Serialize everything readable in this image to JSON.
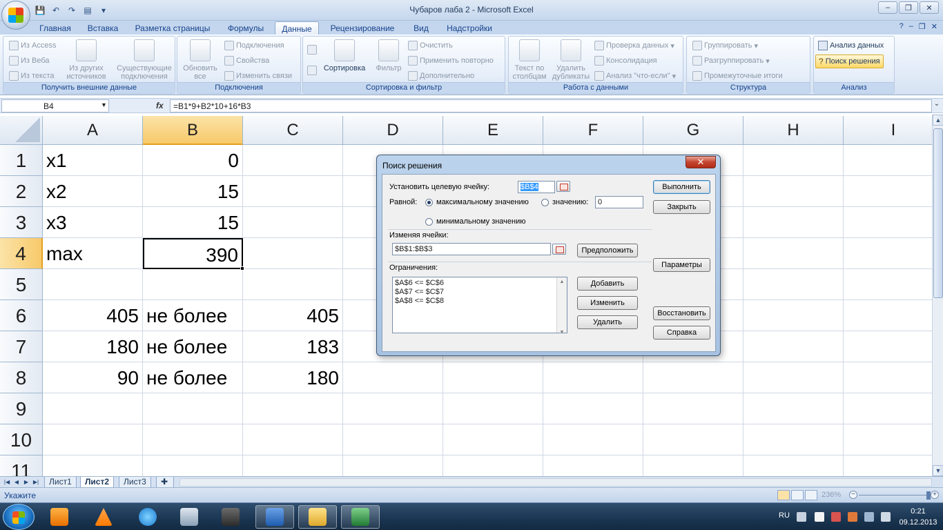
{
  "window": {
    "title": "Чубаров лаба 2 - Microsoft Excel",
    "controls": [
      "–",
      "❐",
      "✕"
    ]
  },
  "ribbon": {
    "tabs": [
      "Главная",
      "Вставка",
      "Разметка страницы",
      "Формулы",
      "Данные",
      "Рецензирование",
      "Вид",
      "Надстройки"
    ],
    "active_tab": "Данные",
    "groups": {
      "external": {
        "label": "Получить внешние данные",
        "from_access": "Из Access",
        "from_web": "Из Веба",
        "from_text": "Из текста",
        "other_sources_1": "Из других",
        "other_sources_2": "источников",
        "existing_1": "Существующие",
        "existing_2": "подключения"
      },
      "connections": {
        "label": "Подключения",
        "refresh_1": "Обновить",
        "refresh_2": "все",
        "connections": "Подключения",
        "properties": "Свойства",
        "edit_links": "Изменить связи"
      },
      "sort_filter": {
        "label": "Сортировка и фильтр",
        "sort": "Сортировка",
        "filter": "Фильтр",
        "clear": "Очистить",
        "reapply": "Применить повторно",
        "advanced": "Дополнительно"
      },
      "data_tools": {
        "label": "Работа с данными",
        "text_to_columns_1": "Текст по",
        "text_to_columns_2": "столбцам",
        "remove_dup_1": "Удалить",
        "remove_dup_2": "дубликаты",
        "validation": "Проверка данных",
        "consolidate": "Консолидация",
        "what_if": "Анализ \"что-если\""
      },
      "outline": {
        "label": "Структура",
        "group": "Группировать",
        "ungroup": "Разгруппировать",
        "subtotal": "Промежуточные итоги"
      },
      "analysis": {
        "label": "Анализ",
        "data_analysis": "Анализ данных",
        "solver": "Поиск решения"
      }
    }
  },
  "formula_bar": {
    "name_box": "B4",
    "fx": "fx",
    "formula": "=B1*9+B2*10+16*B3"
  },
  "grid": {
    "columns": [
      "A",
      "B",
      "C",
      "D",
      "E",
      "F",
      "G",
      "H",
      "I"
    ],
    "selected_column": "B",
    "rows": [
      "1",
      "2",
      "3",
      "4",
      "5",
      "6",
      "7",
      "8",
      "9",
      "10",
      "11"
    ],
    "selected_row": "4",
    "cells": {
      "A1": "x1",
      "B1": "0",
      "A2": "x2",
      "B2": "15",
      "A3": "x3",
      "B3": "15",
      "A4": "max",
      "B4": "390",
      "A6": "405",
      "B6": "не более",
      "C6": "405",
      "A7": "180",
      "B7": "не более",
      "C7": "183",
      "A8": "90",
      "B8": "не более",
      "C8": "180"
    }
  },
  "sheets": {
    "tabs": [
      "Лист1",
      "Лист2",
      "Лист3"
    ],
    "active": "Лист2"
  },
  "status": {
    "mode": "Укажите",
    "zoom": "236%"
  },
  "taskbar": {
    "lang": "RU",
    "time": "0:21",
    "date": "09.12.2013"
  },
  "dialog": {
    "title": "Поиск решения",
    "close": "✕",
    "target_label": "Установить целевую ячейку:",
    "target_value": "$B$4",
    "equal_label": "Равной:",
    "max_label": "максимальному значению",
    "value_label": "значению:",
    "value_input": "0",
    "min_label": "минимальному значению",
    "changing_label": "Изменяя ячейки:",
    "changing_value": "$B$1:$B$3",
    "guess_btn": "Предположить",
    "constraints_label": "Ограничения:",
    "constraints": [
      "$A$6 <= $C$6",
      "$A$7 <= $C$7",
      "$A$8 <= $C$8"
    ],
    "add_btn": "Добавить",
    "change_btn": "Изменить",
    "delete_btn": "Удалить",
    "solve_btn": "Выполнить",
    "close_btn": "Закрыть",
    "options_btn": "Параметры",
    "reset_btn": "Восстановить",
    "help_btn": "Справка"
  }
}
